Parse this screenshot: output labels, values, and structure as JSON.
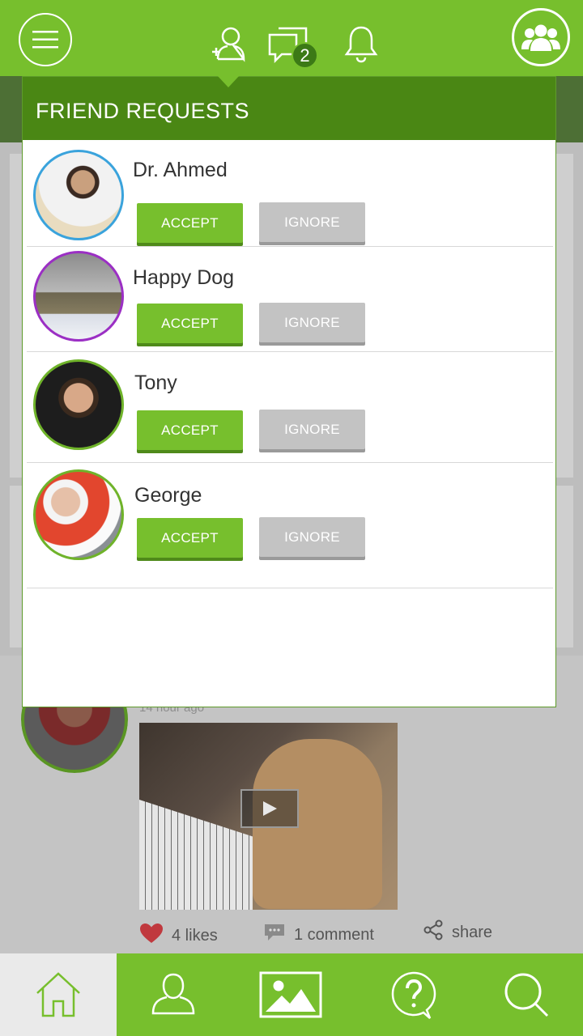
{
  "colors": {
    "brand_green": "#77bf2d",
    "header_dark_green": "#4a8714",
    "accept_green": "#77bf2d",
    "ignore_gray": "#c3c3c3"
  },
  "top_bar": {
    "menu_icon": "hamburger-menu-icon",
    "add_friend_icon": "add-user-icon",
    "messages_icon": "chat-bubbles-icon",
    "messages_badge": "2",
    "notifications_icon": "bell-icon",
    "groups_icon": "group-icon"
  },
  "friend_requests": {
    "title": "FRIEND REQUESTS",
    "items": [
      {
        "name": "Dr. Ahmed",
        "accept_label": "ACCEPT",
        "ignore_label": "IGNORE",
        "ring_color": "#3aa3dc"
      },
      {
        "name": "Happy Dog",
        "accept_label": "ACCEPT",
        "ignore_label": "IGNORE",
        "ring_color": "#9b2fc4"
      },
      {
        "name": "Tony",
        "accept_label": "ACCEPT",
        "ignore_label": "IGNORE",
        "ring_color": "#6fb32a"
      },
      {
        "name": "George",
        "accept_label": "ACCEPT",
        "ignore_label": "IGNORE",
        "ring_color": "#6fb32a"
      }
    ]
  },
  "feed_post": {
    "time": "14 hour ago",
    "likes": "4 likes",
    "comments": "1 comment",
    "share": "share"
  },
  "bottom_nav": {
    "items": [
      "home-icon",
      "profile-icon",
      "gallery-icon",
      "help-icon",
      "search-icon"
    ],
    "active": "home-icon"
  }
}
